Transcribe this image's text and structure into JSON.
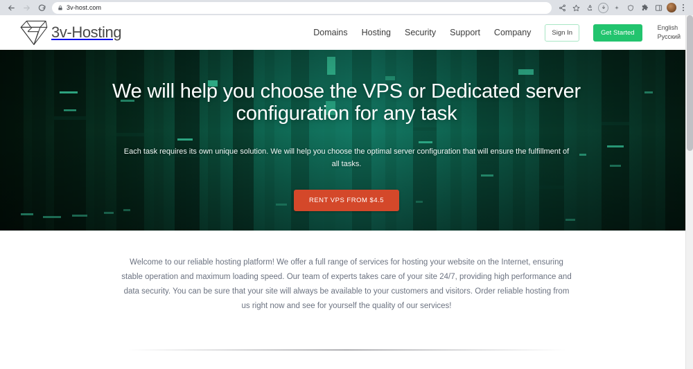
{
  "browser": {
    "back_icon": "back-arrow-icon",
    "forward_icon": "forward-arrow-icon",
    "reload_icon": "reload-icon",
    "lock_icon": "lock-icon",
    "url": "3v-host.com",
    "toolbar_icons": [
      "share-icon",
      "bookmark-star-icon",
      "recycle-icon",
      "download-circle-icon",
      "sparkle-icon",
      "shield-icon",
      "extensions-puzzle-icon",
      "side-panel-icon",
      "profile-avatar-icon",
      "three-dot-menu-icon"
    ]
  },
  "header": {
    "logo_text": "3v-Hosting",
    "logo_mark": "diamond-gem-icon",
    "nav": [
      {
        "label": "Domains"
      },
      {
        "label": "Hosting"
      },
      {
        "label": "Security"
      },
      {
        "label": "Support"
      },
      {
        "label": "Company"
      }
    ],
    "sign_in_label": "Sign In",
    "get_started_label": "Get Started",
    "languages": [
      {
        "label": "English"
      },
      {
        "label": "Русский"
      }
    ]
  },
  "hero": {
    "title": "We will help you choose the VPS or Dedicated server configuration for any task",
    "subtitle": "Each task requires its own unique solution. We will help you choose the optimal server configuration that will ensure the fulfillment of all tasks.",
    "cta_label": "RENT VPS FROM $4.5",
    "background": "server-room-photo"
  },
  "intro": {
    "paragraph": "Welcome to our reliable hosting platform! We offer a full range of services for hosting your website on the Internet, ensuring stable operation and maximum loading speed. Our team of experts takes care of your site 24/7, providing high performance and data security. You can be sure that your site will always be available to your customers and visitors. Order reliable hosting from us right now and see for yourself the quality of our services!"
  },
  "colors": {
    "brand_green": "#22c46e",
    "cta_orange": "#d4482a",
    "hero_dark": "#042018",
    "hero_teal": "#0d6b54",
    "chrome_gray": "#dee1e6"
  }
}
